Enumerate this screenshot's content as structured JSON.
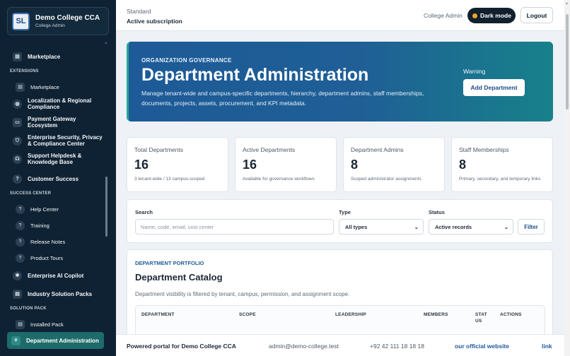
{
  "brand": {
    "logo_text": "SL",
    "name": "Demo College CCA",
    "role": "College Admin"
  },
  "sidebar": {
    "top_item": "Marketplace",
    "sections": {
      "extensions": "EXTENSIONS",
      "success_center": "SUCCESS CENTER",
      "solution_pack": "SOLUTION PACK"
    },
    "items": [
      {
        "label": "Marketplace"
      },
      {
        "label": "Localization & Regional Compliance"
      },
      {
        "label": "Payment Gateway Ecosystem"
      },
      {
        "label": "Enterprise Security, Privacy & Compliance Center"
      },
      {
        "label": "Support Helpdesk & Knowledge Base"
      },
      {
        "label": "Customer Success"
      },
      {
        "label": "Help Center"
      },
      {
        "label": "Training"
      },
      {
        "label": "Release Notes"
      },
      {
        "label": "Product Tours"
      },
      {
        "label": "Enterprise AI Copilot"
      },
      {
        "label": "Industry Solution Packs"
      },
      {
        "label": "Installed Pack"
      }
    ],
    "active_item": "Department Administration"
  },
  "topbar": {
    "plan_label": "Standard",
    "plan_value": "Active subscription",
    "user_label": "College Admin",
    "dark_mode_label": "Dark mode",
    "logout_label": "Logout"
  },
  "hero": {
    "eyebrow": "ORGANIZATION GOVERNANCE",
    "title": "Department Administration",
    "description": "Manage tenant-wide and campus-specific departments, hierarchy, department admins, staff memberships, documents, projects, assets, procurement, and KPI metadata.",
    "warning": "Warning",
    "add_button": "Add Department"
  },
  "stats": [
    {
      "label": "Total Departments",
      "value": "16",
      "note": "3 tenant-wide / 13 campus-scoped"
    },
    {
      "label": "Active Departments",
      "value": "16",
      "note": "Available for governance workflows"
    },
    {
      "label": "Department Admins",
      "value": "8",
      "note": "Scoped administrator assignments"
    },
    {
      "label": "Staff Memberships",
      "value": "8",
      "note": "Primary, secondary, and temporary links"
    }
  ],
  "filter": {
    "search_label": "Search",
    "search_placeholder": "Name, code, email, cost center",
    "type_label": "Type",
    "type_value": "All types",
    "status_label": "Status",
    "status_value": "Active records",
    "filter_button": "Filter"
  },
  "portfolio": {
    "eyebrow": "DEPARTMENT PORTFOLIO",
    "title": "Department Catalog",
    "description": "Department visibility is filtered by tenant, campus, permission, and assignment scope.",
    "columns": [
      "DEPARTMENT",
      "SCOPE",
      "LEADERSHIP",
      "MEMBERS",
      "STAT US",
      "ACTIONS"
    ]
  },
  "footer": {
    "powered": "Powered portal for Demo College CCA",
    "email": "admin@demo-college.test",
    "phone": "+92 42 111 18 18 18",
    "website": "our official website",
    "link": "link"
  },
  "colors": {
    "sidebar_bg": "#0f2233",
    "accent_blue": "#1c5b9a",
    "active_teal": "#1e6b6b",
    "warning_dot": "#f5a524"
  }
}
